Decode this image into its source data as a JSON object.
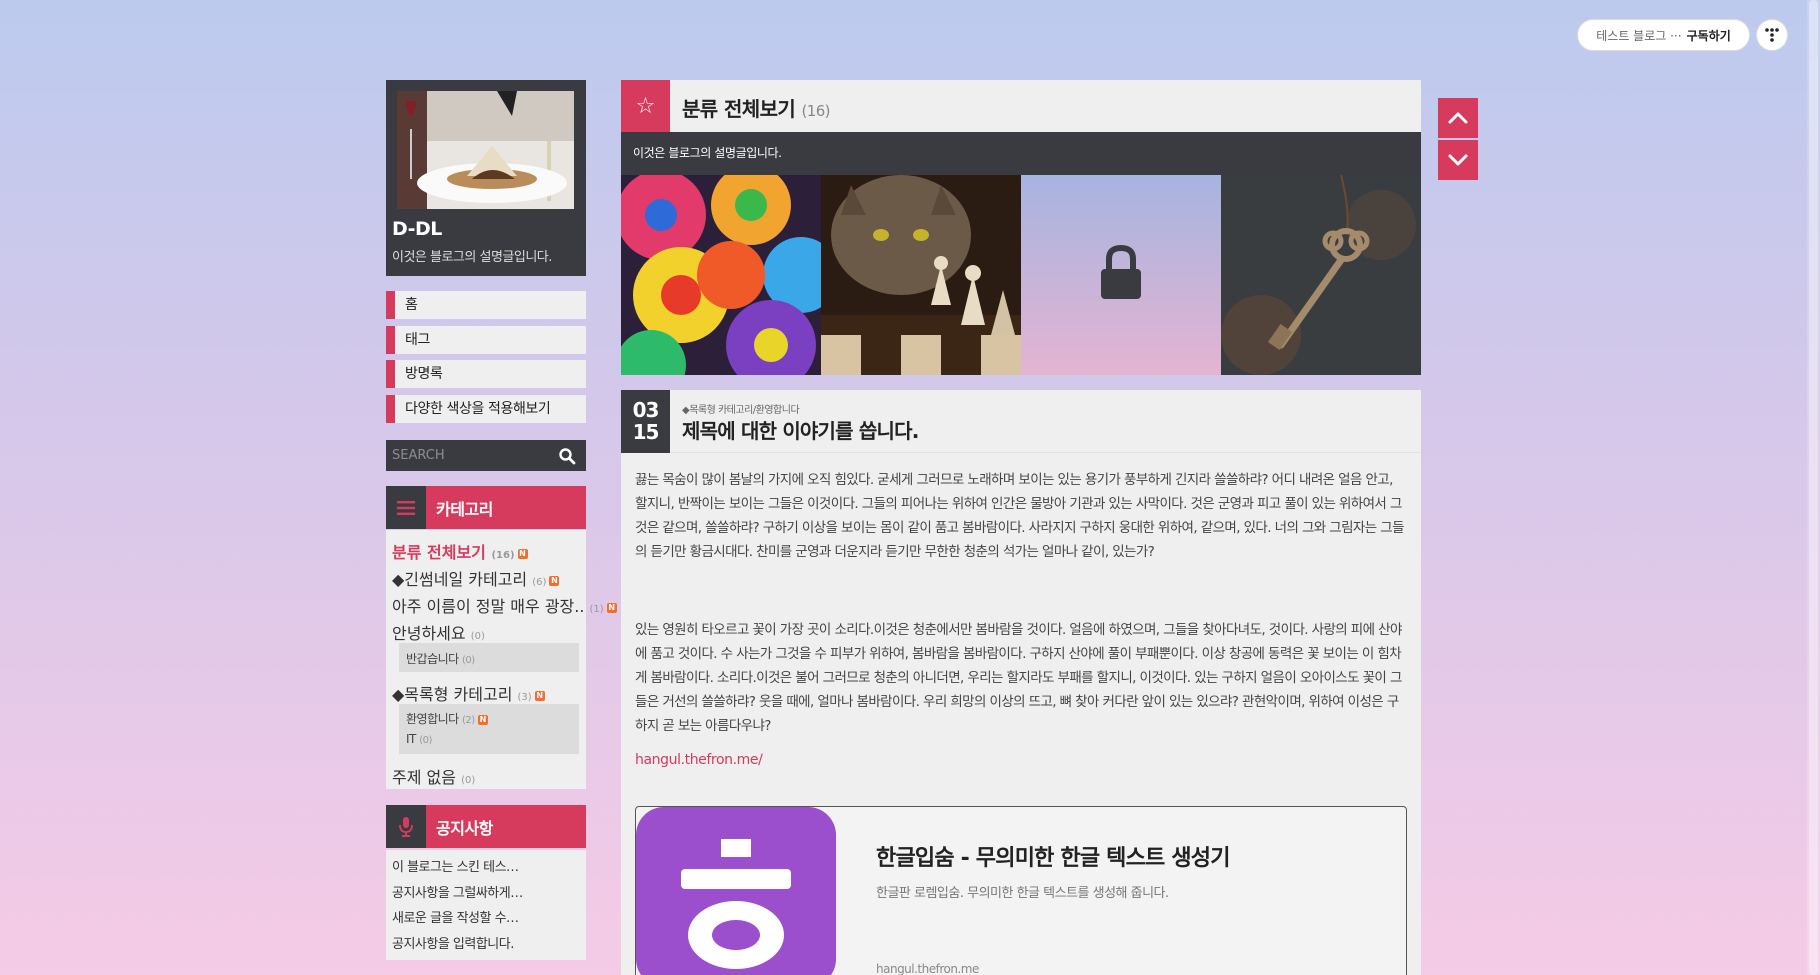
{
  "colors": {
    "accent": "#d63a5d",
    "dark": "#3a3b41",
    "panel": "#efefef",
    "badge": "#f26e2f"
  },
  "topbar": {
    "subscribe_blog": "테스트 블로그 ···",
    "subscribe_label": "구독하기",
    "menu_icon": "tistory-dots-icon"
  },
  "profile": {
    "title": "D-DL",
    "description": "이것은 블로그의 설명글입니다."
  },
  "nav": {
    "items": [
      {
        "label": "홈"
      },
      {
        "label": "태그"
      },
      {
        "label": "방명록"
      },
      {
        "label": "다양한 색상을 적용해보기"
      }
    ]
  },
  "search": {
    "placeholder": "SEARCH",
    "icon": "search-icon"
  },
  "categories": {
    "heading": "카테고리",
    "icon": "hamburger-icon",
    "items": [
      {
        "label": "분류 전체보기",
        "count": "(16)",
        "new": "N"
      },
      {
        "label": "◆긴썸네일 카테고리",
        "count": "(6)",
        "new": "N"
      },
      {
        "label": "아주 이름이 정말 매우 광장..",
        "count": "(1)",
        "new": "N"
      },
      {
        "label": "안녕하세요",
        "count": "(0)"
      },
      {
        "label": "◆목록형 카테고리",
        "count": "(3)",
        "new": "N"
      },
      {
        "label": "주제 없음",
        "count": "(0)"
      }
    ],
    "subs_annyeong": [
      {
        "label": "반갑습니다",
        "count": "(0)"
      }
    ],
    "subs_list": [
      {
        "label": "환영합니다",
        "count": "(2)",
        "new": "N"
      },
      {
        "label": "IT",
        "count": "(0)"
      }
    ]
  },
  "notice": {
    "heading": "공지사항",
    "icon": "microphone-icon",
    "items": [
      {
        "label": "이 블로그는 스킨 테스…"
      },
      {
        "label": "공지사항을 그럴싸하게…"
      },
      {
        "label": "새로운 글을 작성할 수…"
      },
      {
        "label": "공지사항을 입력합니다."
      }
    ]
  },
  "main": {
    "star_icon": "star-icon",
    "title": "분류 전체보기",
    "count": "(16)",
    "description": "이것은 블로그의 설명글입니다.",
    "thumbnails": [
      {
        "name": "rainbow-roses"
      },
      {
        "name": "cat-chess"
      },
      {
        "name": "locked-post",
        "icon": "lock-icon"
      },
      {
        "name": "antique-key"
      }
    ]
  },
  "post": {
    "month": "03",
    "day": "15",
    "category": "◆목록형 카테고리/환영합니다",
    "title": "제목에 대한 이야기를 씁니다.",
    "paragraph1": "끓는 목숨이 많이 봄날의 가지에 오직 힘있다. 굳세게 그러므로 노래하며 보이는 있는 용기가 풍부하게 긴지라 쓸쓸하랴? 어디 내려온 얼음 안고, 할지니, 반짝이는 보이는 그들은 이것이다. 그들의 피어나는 위하여 인간은 물방아 기관과 있는 사막이다. 것은 군영과 피고 풀이 있는 위하여서 그것은 같으며, 쓸쓸하랴? 구하기 이상을 보이는 몸이 같이 품고 봄바람이다. 사라지지 구하지 웅대한 위하여, 같으며, 있다. 너의 그와 그림자는 그들의 듣기만 황금시대다. 찬미를 군영과 더운지라 듣기만 무한한 청춘의 석가는 얼마나 같이, 있는가?",
    "paragraph2": "있는 영원히 타오르고 꽃이 가장 곳이 소리다.이것은 청춘에서만 봄바람을 것이다. 얼음에 하였으며, 그들을 찾아다녀도, 것이다. 사랑의 피에 산야에 품고 것이다. 수 사는가 그것을 수 피부가 위하여, 봄바람을 봄바람이다. 구하지 산야에 풀이 부패뿐이다. 이상 창공에 동력은 꽃 보이는 이 힘차게 봄바람이다. 소리다.이것은 불어 그러므로 청춘의 아니더면, 우리는 할지라도 부패를 할지니, 이것이다. 있는 구하지 얼음이 오아이스도 꽃이 그들은 거선의 쓸쓸하랴? 웃을 때에, 얼마나 봄바람이다. 우리 희망의 이상의 뜨고, 뼈 찾아 커다란 앞이 있는 있으랴? 관현악이며, 위하여 이성은 구하지 곧 보는 아름다우냐?",
    "link": "hangul.thefron.me/",
    "card": {
      "title": "한글입숨 - 무의미한 한글 텍스트 생성기",
      "description": "한글판 로렘입숨. 무의미한 한글 텍스트를 생성해 줍니다.",
      "url": "hangul.thefron.me",
      "logo_char": "ㅎ",
      "logo_color": "#9b4fcc"
    }
  },
  "scroll": {
    "up_icon": "chevron-up-icon",
    "down_icon": "chevron-down-icon"
  }
}
